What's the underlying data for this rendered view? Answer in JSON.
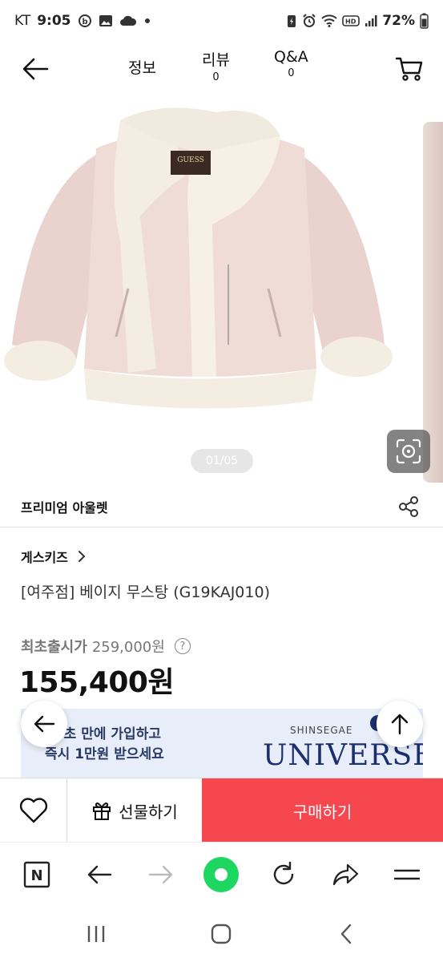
{
  "status_bar": {
    "carrier": "KT",
    "time": "9:05",
    "battery": "72%"
  },
  "header": {
    "tabs": [
      {
        "label": "정보",
        "count": ""
      },
      {
        "label": "리뷰",
        "count": "0"
      },
      {
        "label": "Q&A",
        "count": "0"
      }
    ]
  },
  "gallery": {
    "page_indicator": "01/05",
    "logo_text": "GUESS"
  },
  "store": {
    "name": "프리미엄 아울렛"
  },
  "product": {
    "brand": "게스키즈",
    "name": "[여주점] 베이지 무스탕 (G19KAJ010)",
    "original_price_label": "최초출시가",
    "original_price": "259,000원",
    "sale_price": "155,400원"
  },
  "banner": {
    "line1": "10초 만에 가입하고",
    "line2": "즉시 1만원 받으세요",
    "brand_sub": "SHINSEGAE",
    "brand": "UNIVERSE"
  },
  "purchase_bar": {
    "gift_label": "선물하기",
    "buy_label": "구매하기",
    "buy_color": "#f6474f"
  },
  "browser": {
    "home_label": "N",
    "accent": "#1ed760"
  }
}
